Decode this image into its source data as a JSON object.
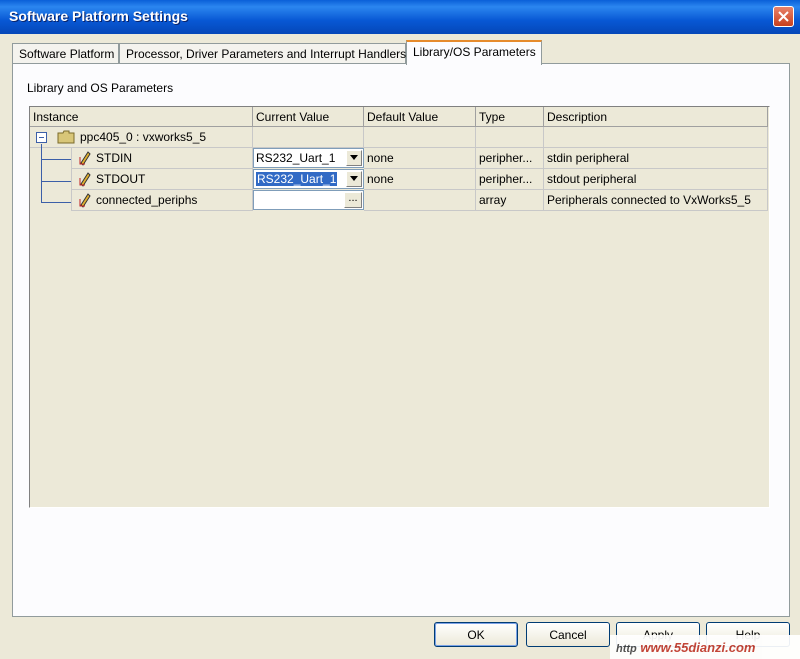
{
  "window": {
    "title": "Software Platform Settings"
  },
  "tabs": [
    {
      "label": "Software Platform"
    },
    {
      "label": "Processor, Driver Parameters and Interrupt Handlers"
    },
    {
      "label": "Library/OS Parameters"
    }
  ],
  "panel": {
    "group_label": "Library and OS Parameters"
  },
  "grid": {
    "headers": [
      "Instance",
      "Current Value",
      "Default Value",
      "Type",
      "Description"
    ],
    "root": {
      "label": "ppc405_0 : vxworks5_5"
    },
    "rows": [
      {
        "instance": "STDIN",
        "current": "RS232_Uart_1",
        "default": "none",
        "type": "peripher...",
        "description": "stdin peripheral"
      },
      {
        "instance": "STDOUT",
        "current": "RS232_Uart_1",
        "default": "none",
        "type": "peripher...",
        "description": "stdout peripheral"
      },
      {
        "instance": "connected_periphs",
        "current": "",
        "default": "",
        "type": "array",
        "description": "Peripherals connected to VxWorks5_5",
        "ellipsis": "..."
      }
    ]
  },
  "buttons": {
    "ok": "OK",
    "cancel": "Cancel",
    "apply": "Apply",
    "help": "Help"
  },
  "watermark": {
    "text": "www.55dianzi.com",
    "prefix": "http"
  },
  "icons": {
    "close": "close-icon",
    "tree_toggle": "minus-box-icon",
    "folder": "folder-icon",
    "param": "pencil-param-icon",
    "dropdown": "chevron-down-icon"
  }
}
